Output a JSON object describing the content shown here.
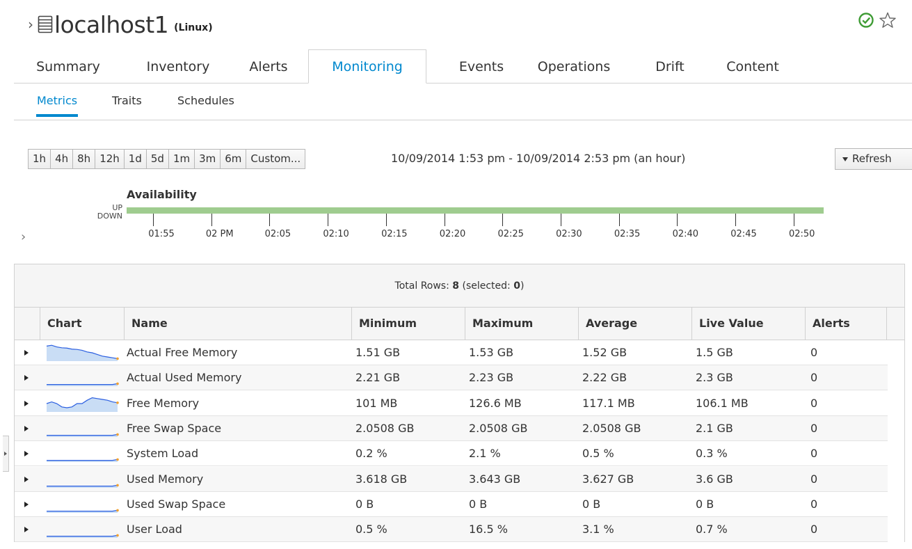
{
  "header": {
    "chevron": "›",
    "title": "localhost1",
    "os_label": "(Linux)",
    "status_icon": "check-circle-icon",
    "favorite_icon": "star-outline-icon",
    "status_color": "#3f9c35"
  },
  "tabs": [
    {
      "label": "Summary"
    },
    {
      "label": "Inventory"
    },
    {
      "label": "Alerts"
    },
    {
      "label": "Monitoring",
      "active": true
    },
    {
      "label": "Events"
    },
    {
      "label": "Operations"
    },
    {
      "label": "Drift"
    },
    {
      "label": "Content"
    }
  ],
  "subtabs": [
    {
      "label": "Metrics",
      "active": true
    },
    {
      "label": "Traits"
    },
    {
      "label": "Schedules"
    }
  ],
  "range_buttons": [
    "1h",
    "4h",
    "8h",
    "12h",
    "1d",
    "5d",
    "1m",
    "3m",
    "6m",
    "Custom..."
  ],
  "range_text": "10/09/2014 1:53 pm - 10/09/2014 2:53 pm (an hour)",
  "refresh_label": "Refresh",
  "availability": {
    "title": "Availability",
    "up_label": "UP",
    "down_label": "DOWN",
    "state": "UP",
    "bar_color": "#9fcc8f",
    "ticks": [
      "01:55",
      "02 PM",
      "02:05",
      "02:10",
      "02:15",
      "02:20",
      "02:25",
      "02:30",
      "02:35",
      "02:40",
      "02:45",
      "02:50"
    ]
  },
  "table": {
    "total_label": "Total Rows:",
    "total_rows": "8",
    "selected_label": "(selected:",
    "selected": "0",
    "selected_close": ")",
    "columns": [
      "Chart",
      "Name",
      "Minimum",
      "Maximum",
      "Average",
      "Live Value",
      "Alerts"
    ],
    "rows": [
      {
        "name": "Actual Free Memory",
        "min": "1.51 GB",
        "max": "1.53 GB",
        "avg": "1.52 GB",
        "live": "1.5 GB",
        "alerts": "0",
        "spark": [
          0.9,
          0.95,
          0.85,
          0.8,
          0.78,
          0.72,
          0.7,
          0.65,
          0.55,
          0.5,
          0.4,
          0.3,
          0.25,
          0.2,
          0.15
        ]
      },
      {
        "name": "Actual Used Memory",
        "min": "2.21 GB",
        "max": "2.23 GB",
        "avg": "2.22 GB",
        "live": "2.3 GB",
        "alerts": "0",
        "spark": [
          0.1,
          0.1,
          0.1,
          0.1,
          0.1,
          0.1,
          0.1,
          0.1,
          0.1,
          0.1,
          0.1,
          0.1,
          0.1,
          0.1,
          0.15
        ]
      },
      {
        "name": "Free Memory",
        "min": "101 MB",
        "max": "126.6 MB",
        "avg": "117.1 MB",
        "live": "106.1 MB",
        "alerts": "0",
        "spark": [
          0.5,
          0.6,
          0.5,
          0.3,
          0.25,
          0.3,
          0.5,
          0.5,
          0.7,
          0.85,
          0.8,
          0.75,
          0.7,
          0.6,
          0.55
        ]
      },
      {
        "name": "Free Swap Space",
        "min": "2.0508 GB",
        "max": "2.0508 GB",
        "avg": "2.0508 GB",
        "live": "2.1 GB",
        "alerts": "0",
        "spark": [
          0.1,
          0.1,
          0.1,
          0.1,
          0.1,
          0.1,
          0.1,
          0.1,
          0.1,
          0.1,
          0.1,
          0.1,
          0.1,
          0.1,
          0.15
        ]
      },
      {
        "name": "System Load",
        "min": "0.2 %",
        "max": "2.1 %",
        "avg": "0.5 %",
        "live": "0.3 %",
        "alerts": "0",
        "spark": [
          0.1,
          0.1,
          0.1,
          0.1,
          0.1,
          0.1,
          0.1,
          0.1,
          0.1,
          0.1,
          0.1,
          0.1,
          0.1,
          0.1,
          0.15
        ]
      },
      {
        "name": "Used Memory",
        "min": "3.618 GB",
        "max": "3.643 GB",
        "avg": "3.627 GB",
        "live": "3.6 GB",
        "alerts": "0",
        "spark": [
          0.1,
          0.1,
          0.1,
          0.1,
          0.1,
          0.1,
          0.1,
          0.1,
          0.1,
          0.1,
          0.1,
          0.1,
          0.1,
          0.1,
          0.15
        ]
      },
      {
        "name": "Used Swap Space",
        "min": "0 B",
        "max": "0 B",
        "avg": "0 B",
        "live": "0 B",
        "alerts": "0",
        "spark": [
          0.1,
          0.1,
          0.1,
          0.1,
          0.1,
          0.1,
          0.1,
          0.1,
          0.1,
          0.1,
          0.1,
          0.1,
          0.1,
          0.1,
          0.15
        ]
      },
      {
        "name": "User Load",
        "min": "0.5 %",
        "max": "16.5 %",
        "avg": "3.1 %",
        "live": "0.7 %",
        "alerts": "0",
        "spark": [
          0.1,
          0.1,
          0.1,
          0.1,
          0.1,
          0.1,
          0.1,
          0.1,
          0.1,
          0.1,
          0.1,
          0.1,
          0.1,
          0.1,
          0.15
        ]
      }
    ]
  },
  "colors": {
    "accent": "#0088ce",
    "spark_line": "#2a5ee0",
    "spark_fill": "#c9ddf5",
    "spark_point": "#f0a030"
  }
}
